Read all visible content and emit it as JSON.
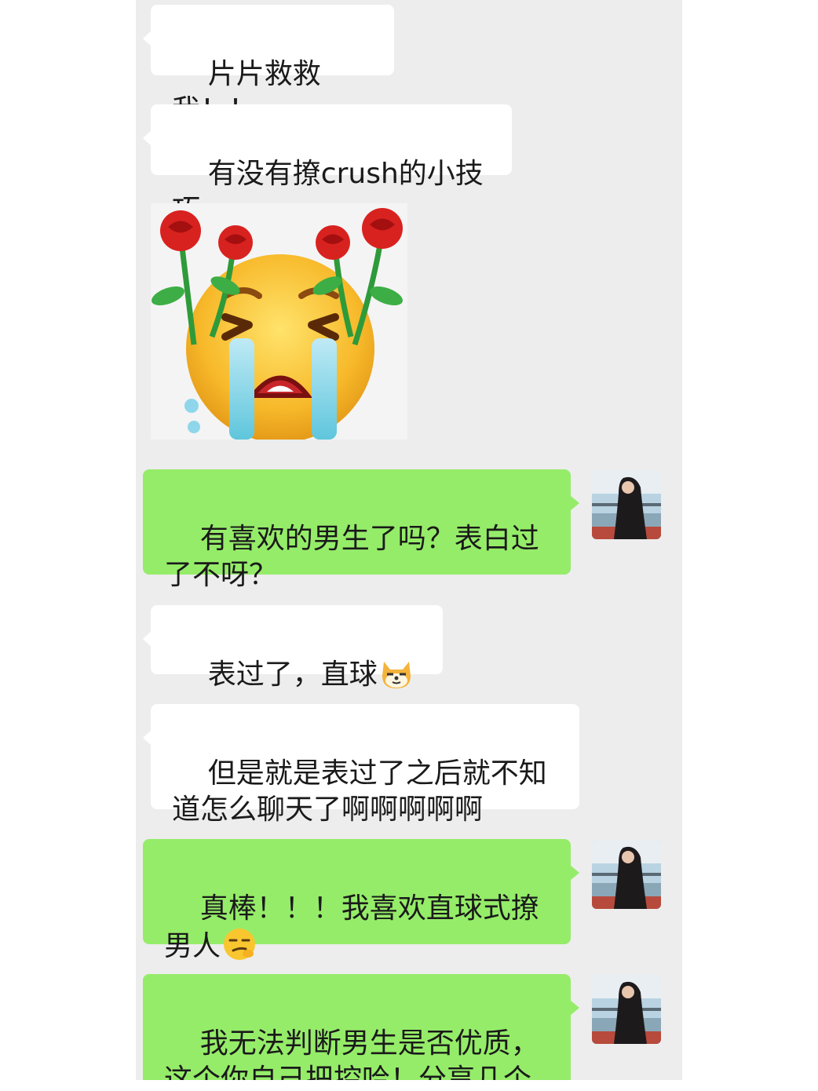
{
  "messages": [
    {
      "direction": "in",
      "text": "片片救救我！！"
    },
    {
      "direction": "in",
      "text": "有没有撩crush的小技巧"
    },
    {
      "direction": "in",
      "sticker": "crying-face-with-roses-sticker"
    },
    {
      "direction": "out",
      "text": "有喜欢的男生了吗？表白过了不呀？"
    },
    {
      "direction": "in",
      "text": "表过了，直球",
      "emoji": "shiba-dog-emoji"
    },
    {
      "direction": "in",
      "text": "但是就是表过了之后就不知道怎么聊天了啊啊啊啊啊"
    },
    {
      "direction": "out",
      "text": "真棒！！！我喜欢直球式撩男人",
      "emoji": "smirk-face-emoji"
    },
    {
      "direction": "out",
      "text": "我无法判断男生是否优质，这个你自己把控哈！分享几个小技巧给你～"
    }
  ],
  "colors": {
    "chat_bg": "#ededed",
    "incoming_bubble": "#ffffff",
    "outgoing_bubble": "#95ec69"
  }
}
